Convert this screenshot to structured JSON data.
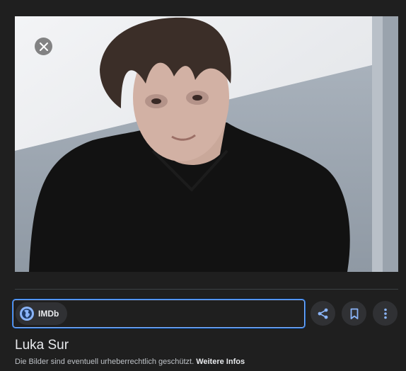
{
  "viewer": {
    "close_icon": "close-icon",
    "image_subject": "person-photo"
  },
  "source": {
    "icon": "globe-icon",
    "label": "IMDb"
  },
  "actions": {
    "share_icon": "share-icon",
    "save_icon": "bookmark-icon",
    "more_icon": "more-vert-icon"
  },
  "result": {
    "title": "Luka Sur",
    "copyright_notice": "Die Bilder sind eventuell urheberrechtlich geschützt.",
    "more_info_link": "Weitere Infos"
  },
  "colors": {
    "background": "#1f1f1f",
    "accent": "#8ab4f8",
    "chip": "#303134"
  }
}
